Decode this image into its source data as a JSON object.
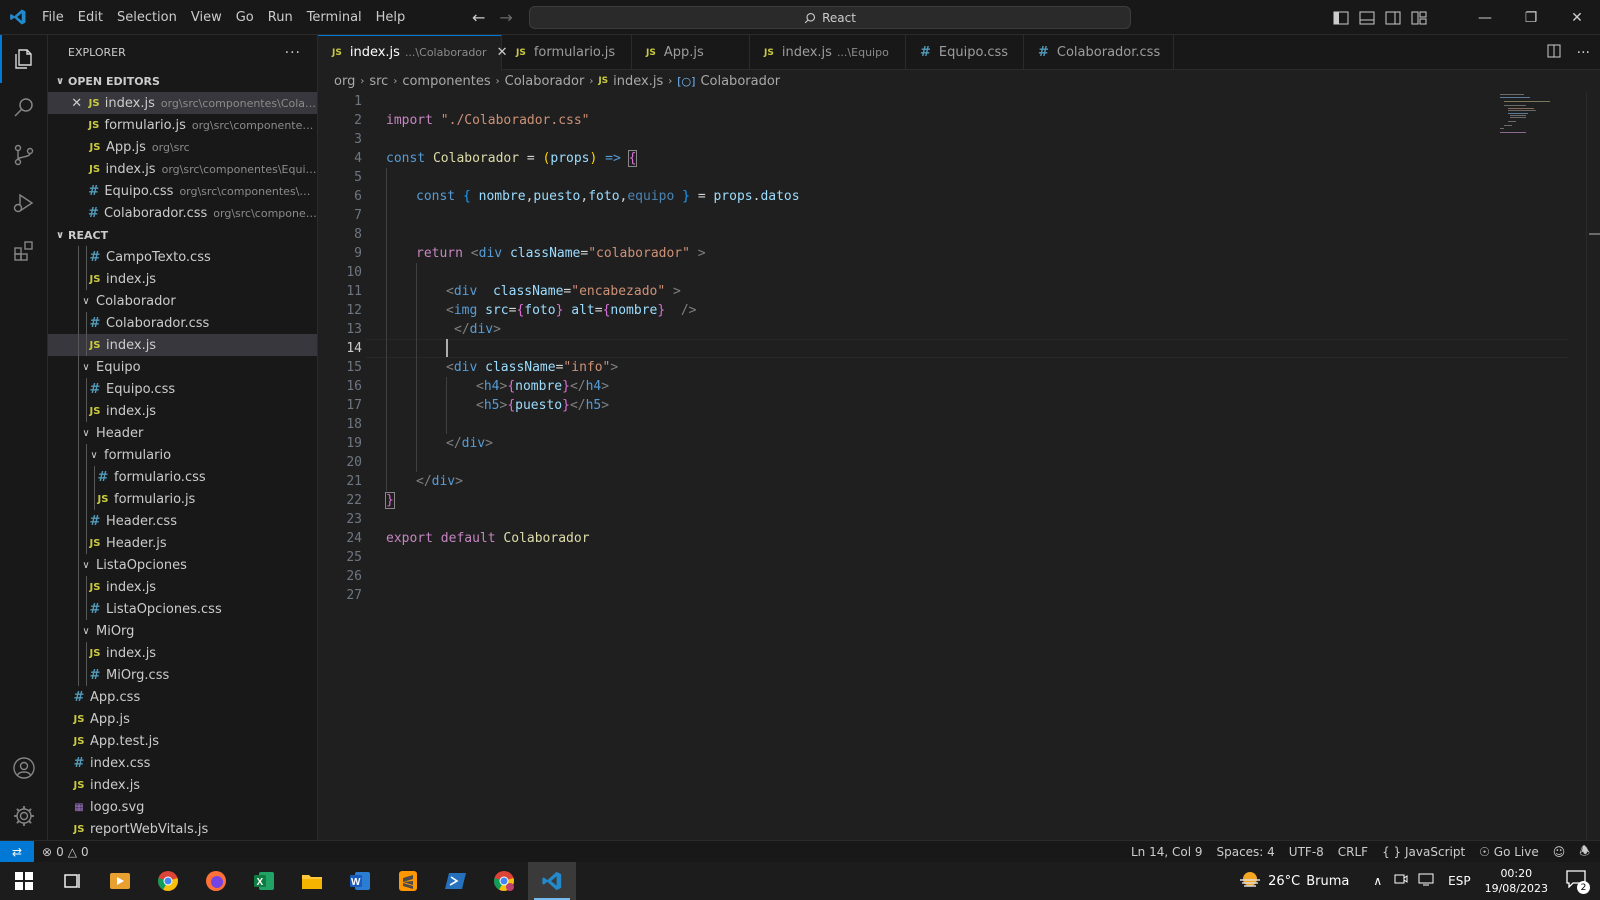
{
  "menu": [
    "File",
    "Edit",
    "Selection",
    "View",
    "Go",
    "Run",
    "Terminal",
    "Help"
  ],
  "command_center": "React",
  "explorer": {
    "title": "EXPLORER",
    "open_editors_label": "OPEN EDITORS",
    "open_editors": [
      {
        "name": "index.js",
        "path": "org\\src\\componentes\\Colab...",
        "type": "js"
      },
      {
        "name": "formulario.js",
        "path": "org\\src\\componentes\\...",
        "type": "js"
      },
      {
        "name": "App.js",
        "path": "org\\src",
        "type": "js"
      },
      {
        "name": "index.js",
        "path": "org\\src\\componentes\\Equipo",
        "type": "js"
      },
      {
        "name": "Equipo.css",
        "path": "org\\src\\componentes\\Eq...",
        "type": "css"
      },
      {
        "name": "Colaborador.css",
        "path": "org\\src\\componen...",
        "type": "css"
      }
    ],
    "project_label": "REACT",
    "tree": [
      {
        "name": "CampoTexto.css",
        "type": "css"
      },
      {
        "name": "index.js",
        "type": "js"
      },
      {
        "name": "Colaborador",
        "type": "folder"
      },
      {
        "name": "Colaborador.css",
        "type": "css"
      },
      {
        "name": "index.js",
        "type": "js"
      },
      {
        "name": "Equipo",
        "type": "folder"
      },
      {
        "name": "Equipo.css",
        "type": "css"
      },
      {
        "name": "index.js",
        "type": "js"
      },
      {
        "name": "Header",
        "type": "folder"
      },
      {
        "name": "formulario",
        "type": "folder"
      },
      {
        "name": "formulario.css",
        "type": "css"
      },
      {
        "name": "formulario.js",
        "type": "js"
      },
      {
        "name": "Header.css",
        "type": "css"
      },
      {
        "name": "Header.js",
        "type": "js"
      },
      {
        "name": "ListaOpciones",
        "type": "folder"
      },
      {
        "name": "index.js",
        "type": "js"
      },
      {
        "name": "ListaOpciones.css",
        "type": "css"
      },
      {
        "name": "MiOrg",
        "type": "folder"
      },
      {
        "name": "index.js",
        "type": "js"
      },
      {
        "name": "MiOrg.css",
        "type": "css"
      },
      {
        "name": "App.css",
        "type": "css"
      },
      {
        "name": "App.js",
        "type": "js"
      },
      {
        "name": "App.test.js",
        "type": "js"
      },
      {
        "name": "index.css",
        "type": "css"
      },
      {
        "name": "index.js",
        "type": "js"
      },
      {
        "name": "logo.svg",
        "type": "svg"
      },
      {
        "name": "reportWebVitals.js",
        "type": "js"
      }
    ]
  },
  "tabs": [
    {
      "name": "index.js",
      "sub": "...\\Colaborador",
      "type": "js"
    },
    {
      "name": "formulario.js",
      "sub": "",
      "type": "js"
    },
    {
      "name": "App.js",
      "sub": "",
      "type": "js"
    },
    {
      "name": "index.js",
      "sub": "...\\Equipo",
      "type": "js"
    },
    {
      "name": "Equipo.css",
      "sub": "",
      "type": "css"
    },
    {
      "name": "Colaborador.css",
      "sub": "",
      "type": "css"
    }
  ],
  "breadcrumb": [
    "org",
    "src",
    "componentes",
    "Colaborador",
    "index.js",
    "Colaborador"
  ],
  "code_lines": [
    "1",
    "2",
    "3",
    "4",
    "5",
    "6",
    "7",
    "8",
    "9",
    "10",
    "11",
    "12",
    "13",
    "14",
    "15",
    "16",
    "17",
    "18",
    "19",
    "20",
    "21",
    "22",
    "23",
    "24",
    "25",
    "26",
    "27"
  ],
  "code": {
    "l2": {
      "kw": "import",
      "str": "\"./Colaborador.css\""
    },
    "l4": {
      "kw": "const",
      "name": "Colaborador",
      "eq": "=",
      "param": "props",
      "arrow": "=>"
    },
    "l6": {
      "kw": "const",
      "fields": [
        "nombre",
        "puesto",
        "foto",
        "equipo"
      ],
      "obj": "props",
      "prop": "datos"
    },
    "l9": {
      "kw": "return",
      "tag": "div",
      "attr": "className",
      "val": "\"colaborador\""
    },
    "l11": {
      "tag": "div",
      "attr": "className",
      "val": "\"encabezado\""
    },
    "l12": {
      "tag": "img",
      "a1": "src",
      "v1": "foto",
      "a2": "alt",
      "v2": "nombre"
    },
    "l13": {
      "tag": "div"
    },
    "l15": {
      "tag": "div",
      "attr": "className",
      "val": "\"info\""
    },
    "l16": {
      "tag": "h4",
      "val": "nombre"
    },
    "l17": {
      "tag": "h5",
      "val": "puesto"
    },
    "l19": {
      "tag": "div"
    },
    "l21": {
      "tag": "div"
    },
    "l24": {
      "kw1": "export",
      "kw2": "default",
      "name": "Colaborador"
    }
  },
  "status": {
    "errors": "0",
    "warnings": "0",
    "position": "Ln 14, Col 9",
    "spaces": "Spaces: 4",
    "encoding": "UTF-8",
    "eol": "CRLF",
    "language": "JavaScript",
    "golive": "Go Live"
  },
  "taskbar": {
    "weather_temp": "26°C",
    "weather_desc": "Bruma",
    "lang": "ESP",
    "time": "00:20",
    "date": "19/08/2023",
    "notif_count": "2"
  },
  "colors": {
    "accent": "#0078d4",
    "js": "#cbcb41",
    "css": "#519aba"
  }
}
